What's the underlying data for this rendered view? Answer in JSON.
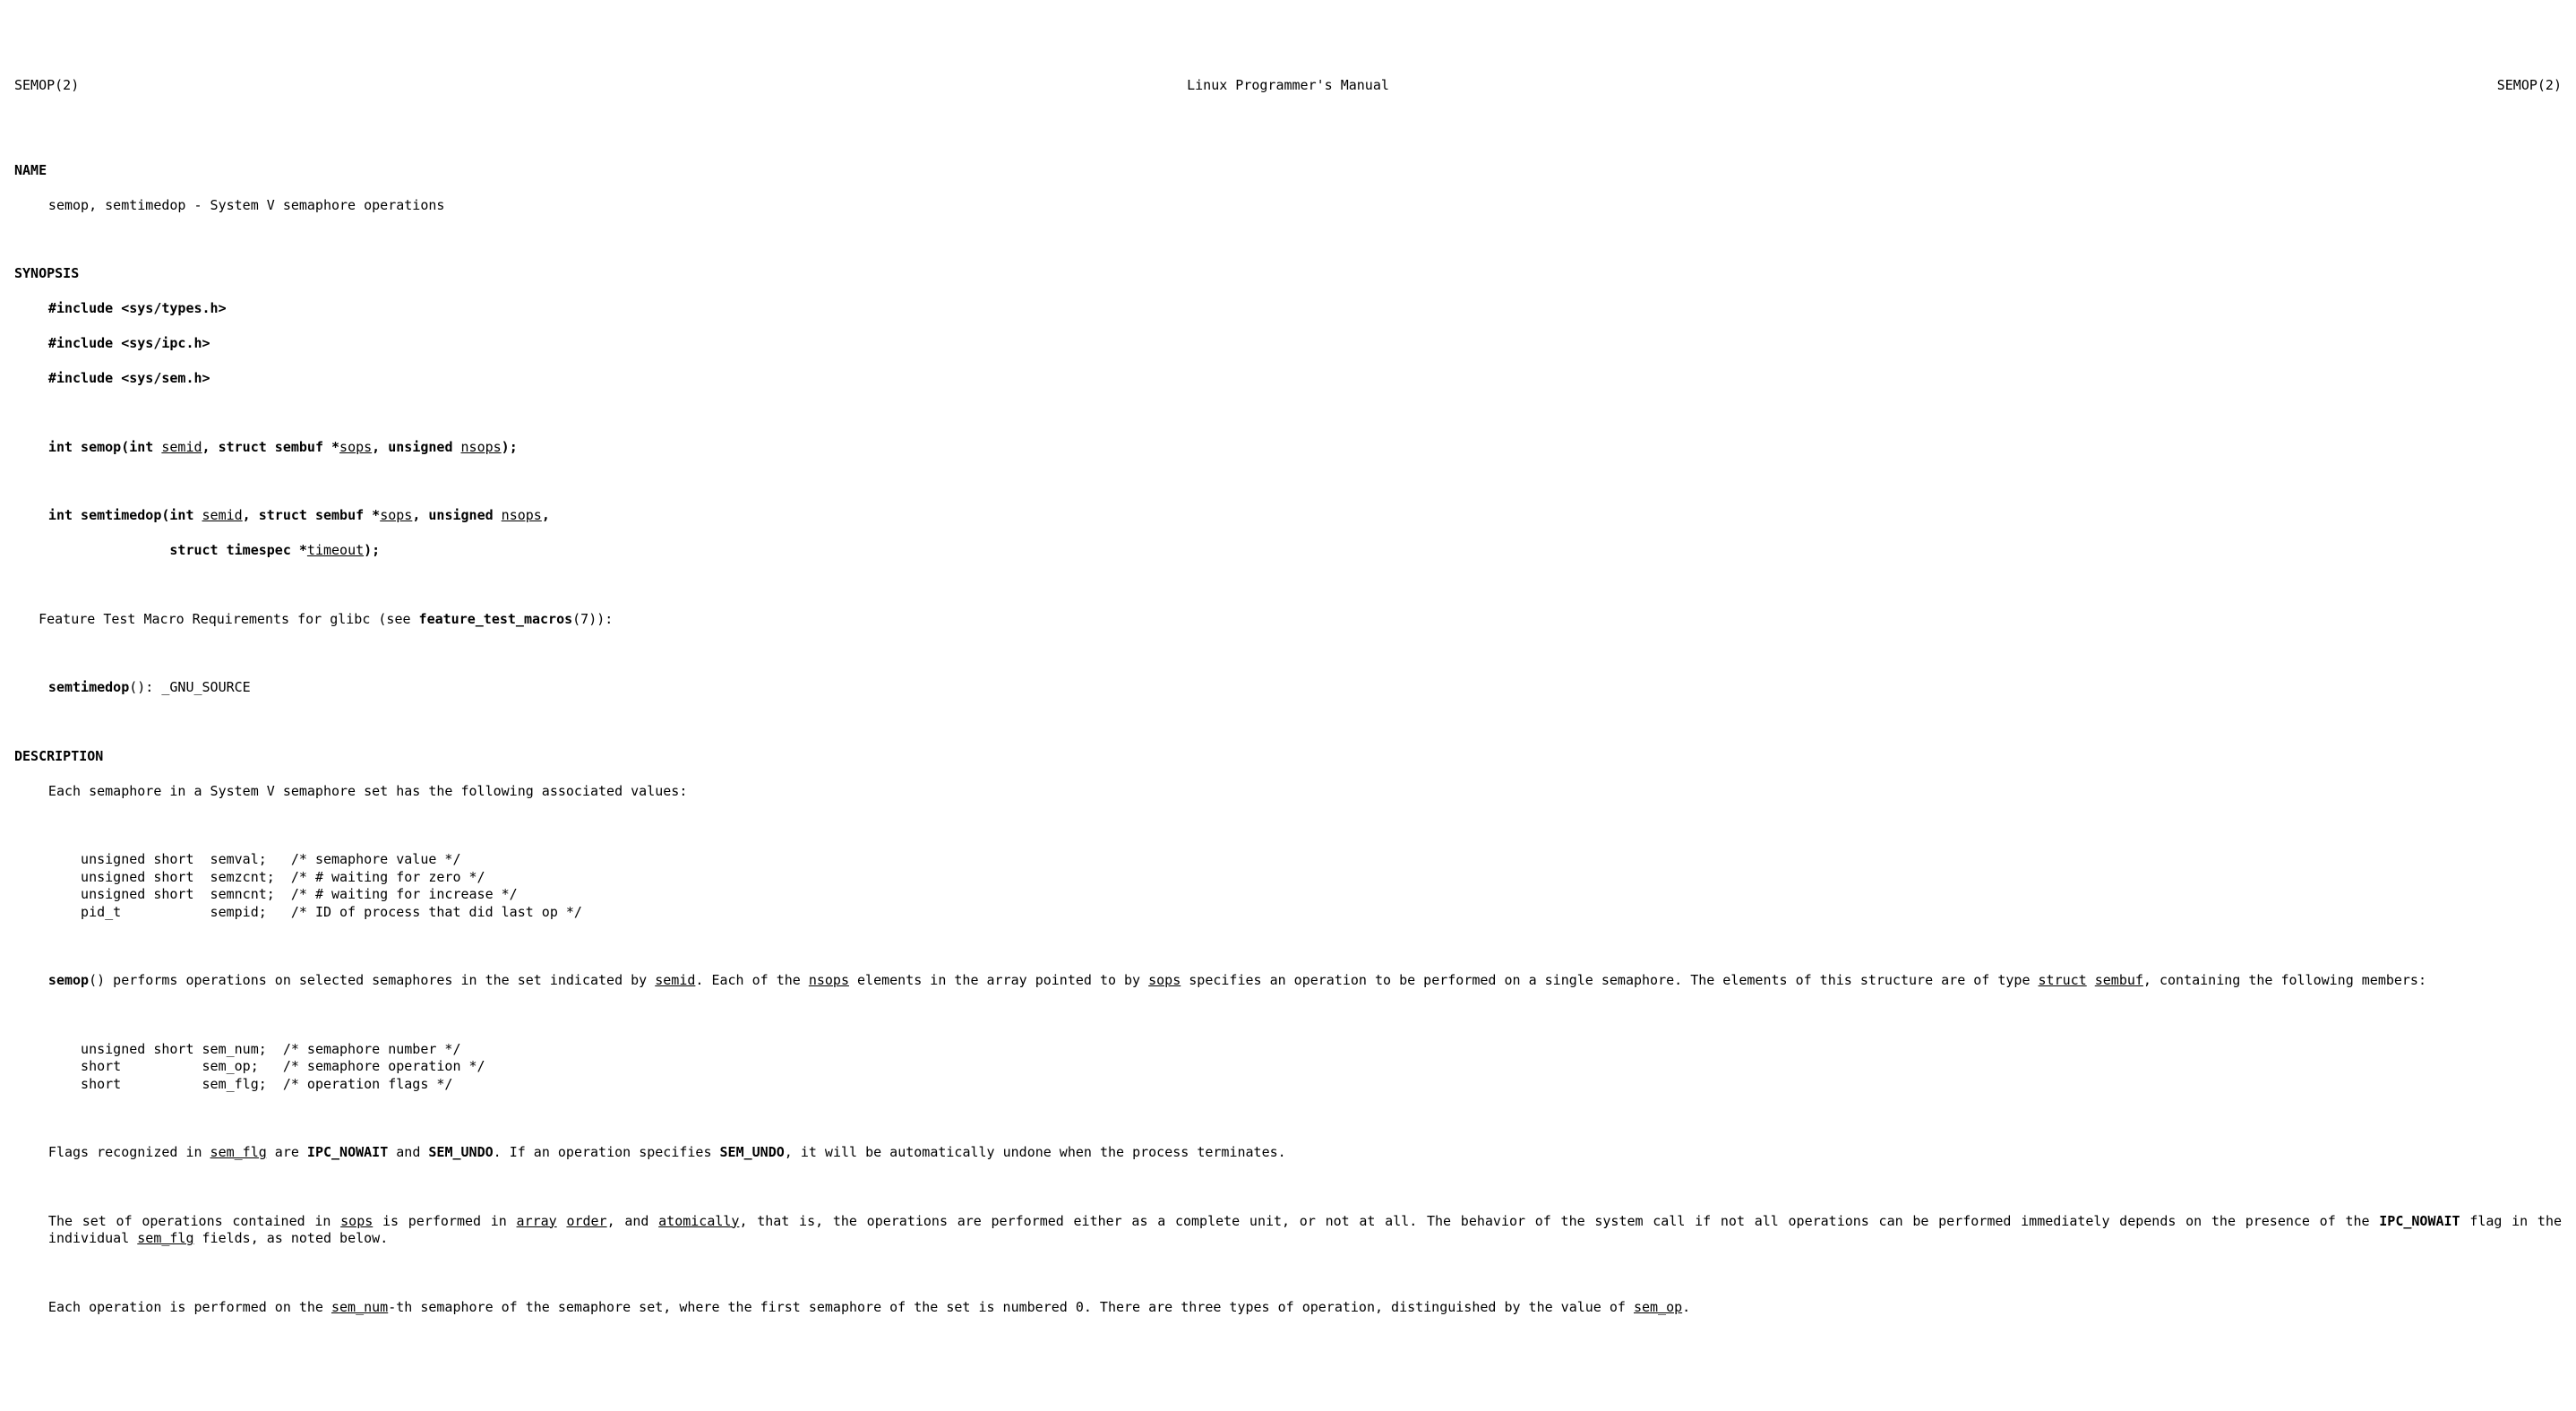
{
  "header": {
    "left": "SEMOP(2)",
    "center": "Linux Programmer's Manual",
    "right": "SEMOP(2)"
  },
  "sections": {
    "name": {
      "title": "NAME",
      "line": "semop, semtimedop - System V semaphore operations"
    },
    "synopsis": {
      "title": "SYNOPSIS",
      "inc1": "#include <sys/types.h>",
      "inc2": "#include <sys/ipc.h>",
      "inc3": "#include <sys/sem.h>",
      "fn1_pre": "int semop(int ",
      "fn1_semid": "semid",
      "fn1_mid1": ", struct sembuf *",
      "fn1_sops": "sops",
      "fn1_mid2": ", unsigned ",
      "fn1_nsops": "nsops",
      "fn1_post": ");",
      "fn2_pre": "int semtimedop(int ",
      "fn2_semid": "semid",
      "fn2_mid1": ", struct sembuf *",
      "fn2_sops": "sops",
      "fn2_mid2": ", unsigned ",
      "fn2_nsops": "nsops",
      "fn2_post": ",",
      "fn2b_pre": "               struct timespec *",
      "fn2b_timeout": "timeout",
      "fn2b_post": ");",
      "ftm_pre": "   Feature Test Macro Requirements for glibc (see ",
      "ftm_bold": "feature_test_macros",
      "ftm_post": "(7)):",
      "ftm2_bold": "semtimedop",
      "ftm2_post": "(): _GNU_SOURCE"
    },
    "description": {
      "title": "DESCRIPTION",
      "p1": "Each semaphore in a System V semaphore set has the following associated values:",
      "struct1": "    unsigned short  semval;   /* semaphore value */\n    unsigned short  semzcnt;  /* # waiting for zero */\n    unsigned short  semncnt;  /* # waiting for increase */\n    pid_t           sempid;   /* ID of process that did last op */",
      "p2_a_bold": "semop",
      "p2_a_text": "()  performs  operations on selected semaphores in the set indicated by ",
      "p2_semid": "semid",
      "p2_b_text": ".  Each of the ",
      "p2_nsops": "nsops",
      "p2_c_text": " elements in the array pointed to by ",
      "p2_sops": "sops",
      "p2_d_text": " specifies an operation to be performed on a single semaphore.  The elements of this structure are of type ",
      "p2_struct": "struct",
      "p2_sp": " ",
      "p2_sembuf": "sembuf",
      "p2_e_text": ", containing the following members:",
      "struct2": "    unsigned short sem_num;  /* semaphore number */\n    short          sem_op;   /* semaphore operation */\n    short          sem_flg;  /* operation flags */",
      "p3_a": "Flags recognized in ",
      "p3_semflg": "sem_flg",
      "p3_b": " are ",
      "p3_ipc": "IPC_NOWAIT",
      "p3_c": " and ",
      "p3_semundo": "SEM_UNDO",
      "p3_d": ".  If an operation specifies ",
      "p3_semundo2": "SEM_UNDO",
      "p3_e": ", it will be automatically undone  when  the  process  terminates.",
      "p4_a": "The  set of operations contained in ",
      "p4_sops": "sops",
      "p4_b": " is performed in ",
      "p4_array": "array",
      "p4_sp": " ",
      "p4_order": "order",
      "p4_c": ", and ",
      "p4_atom": "atomically",
      "p4_d": ", that is, the operations are performed either as a complete unit, or not at all.  The behavior of the system call if not all operations can be performed immediately depends on the presence of the  ",
      "p4_ipc": "IPC_NOWAIT",
      "p4_e": "  flag  in  the individual ",
      "p4_semflg": "sem_flg",
      "p4_f": " fields, as noted below.",
      "p5_a": "Each  operation is performed on the ",
      "p5_semnum": "sem_num",
      "p5_b": "-th semaphore of the semaphore set, where the first semaphore of the set is numbered 0.  There are three types of operation, distinguished by the value of ",
      "p5_semop": "sem_op",
      "p5_c": "."
    }
  }
}
